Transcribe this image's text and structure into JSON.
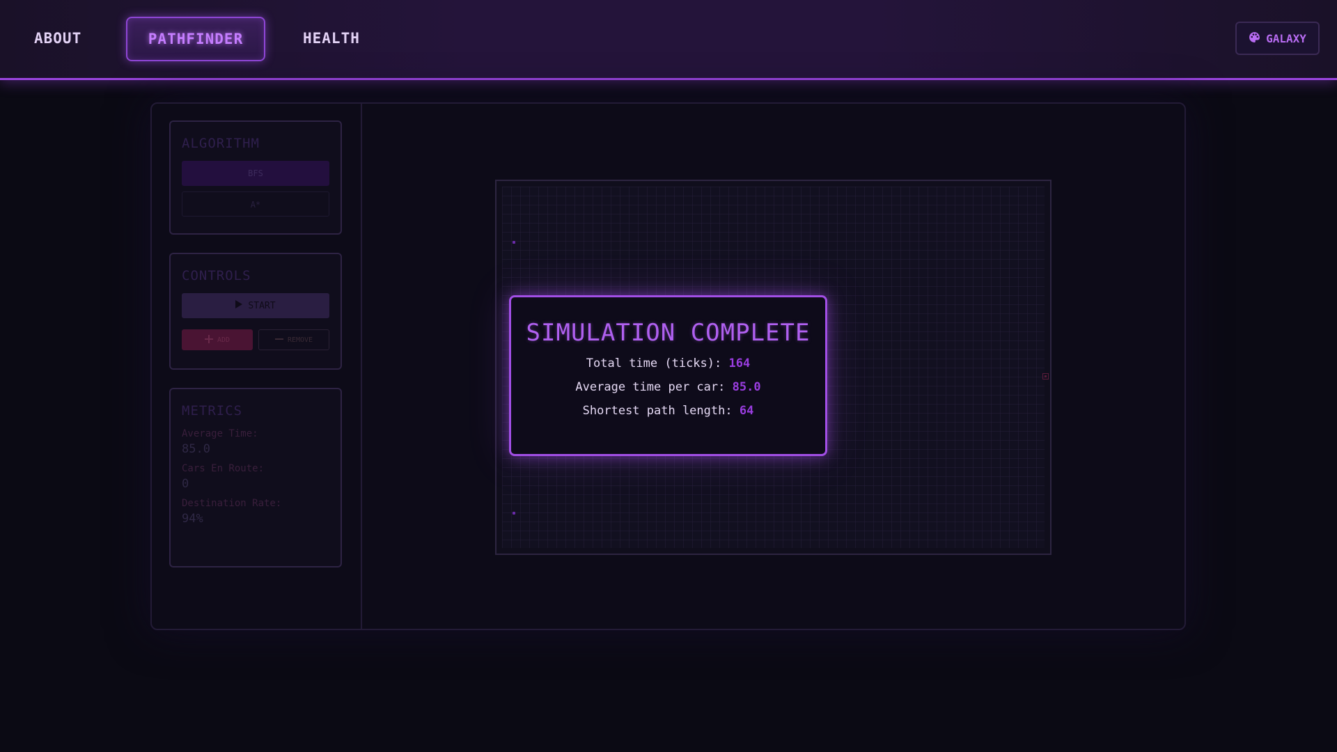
{
  "nav": {
    "items": [
      {
        "label": "ABOUT"
      },
      {
        "label": "PATHFINDER"
      },
      {
        "label": "HEALTH"
      }
    ],
    "active": "PATHFINDER",
    "theme_label": "GALAXY",
    "theme_icon": "palette-icon"
  },
  "sidebar": {
    "algorithm": {
      "title": "ALGORITHM",
      "options": [
        "BFS",
        "A*"
      ],
      "selected": "BFS"
    },
    "controls": {
      "title": "CONTROLS",
      "start_label": "START",
      "start_icon": "play-icon",
      "add_label": "ADD",
      "add_icon": "plus-icon",
      "remove_label": "REMOVE",
      "remove_icon": "minus-icon"
    },
    "metrics": {
      "title": "METRICS",
      "items": [
        {
          "label": "Average Time:",
          "value": "85.0"
        },
        {
          "label": "Cars En Route:",
          "value": "0"
        },
        {
          "label": "Destination Rate:",
          "value": "94%"
        }
      ]
    }
  },
  "modal": {
    "title": "SIMULATION COMPLETE",
    "stats": [
      {
        "label": "Total time (ticks):",
        "value": "164"
      },
      {
        "label": "Average time per car:",
        "value": "85.0"
      },
      {
        "label": "Shortest path length:",
        "value": "64"
      }
    ]
  },
  "colors": {
    "accent": "#a24fe6",
    "background": "#0b0a14",
    "value": "#9a3de0"
  }
}
